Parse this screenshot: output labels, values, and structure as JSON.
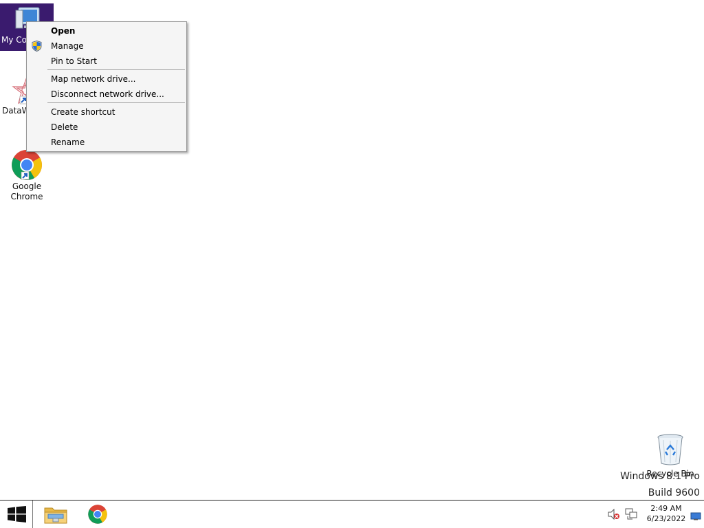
{
  "desktop": {
    "icons": [
      {
        "label": "My Computer",
        "visible_label": "My Co",
        "icon": "computer-icon",
        "selected": true
      },
      {
        "label": "DataWizard",
        "visible_label": "DataW",
        "icon": "datawizard-shortcut-icon"
      },
      {
        "label": "Google Chrome",
        "line1": "Google",
        "line2": "Chrome",
        "icon": "chrome-shortcut-icon"
      },
      {
        "label": "Recycle Bin",
        "icon": "recycle-bin-icon"
      }
    ],
    "watermark": {
      "line1": "Windows 8.1 Pro",
      "line2": "Build 9600"
    }
  },
  "context_menu": {
    "items": [
      {
        "label": "Open",
        "bold": true
      },
      {
        "label": "Manage",
        "icon": "uac-shield-icon"
      },
      {
        "label": "Pin to Start"
      },
      {
        "label": "Map network drive..."
      },
      {
        "label": "Disconnect network drive..."
      },
      {
        "label": "Create shortcut"
      },
      {
        "label": "Delete"
      },
      {
        "label": "Rename"
      }
    ]
  },
  "taskbar": {
    "start_icon": "windows-logo-icon",
    "apps": [
      {
        "name": "File Explorer",
        "icon": "file-explorer-icon"
      },
      {
        "name": "Google Chrome",
        "icon": "chrome-icon"
      }
    ],
    "tray": {
      "icons": [
        "speaker-muted-icon",
        "network-icon",
        "action-center-icon"
      ],
      "time": "2:49 AM",
      "date": "6/23/2022"
    }
  },
  "colors": {
    "selection": "#3a1b6e",
    "background": "#ffffff"
  }
}
